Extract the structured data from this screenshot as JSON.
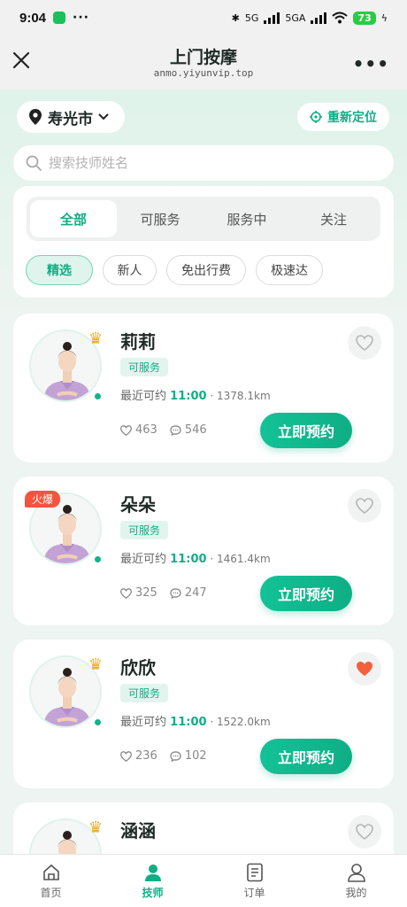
{
  "status_bar": {
    "time": "9:04",
    "network_1": "5G",
    "network_2": "5GA",
    "battery": "73"
  },
  "nav": {
    "title": "上门按摩",
    "subtitle": "anmo.yiyunvip.top"
  },
  "location": {
    "city": "寿光市",
    "relocate_label": "重新定位"
  },
  "search": {
    "placeholder": "搜索技师姓名"
  },
  "tabs": [
    "全部",
    "可服务",
    "服务中",
    "关注"
  ],
  "active_tab": "全部",
  "chips": [
    "精选",
    "新人",
    "免出行费",
    "极速达"
  ],
  "active_chip": "精选",
  "therapists": [
    {
      "name": "莉莉",
      "status": "可服务",
      "avail_label": "最近可约",
      "time": "11:00",
      "distance": "1378.1km",
      "likes": "463",
      "comments": "546",
      "badge": "crown",
      "favorited": false,
      "book_label": "立即预约"
    },
    {
      "name": "朵朵",
      "status": "可服务",
      "avail_label": "最近可约",
      "time": "11:00",
      "distance": "1461.4km",
      "likes": "325",
      "comments": "247",
      "badge": "hot",
      "hot_label": "火爆",
      "favorited": false,
      "book_label": "立即预约"
    },
    {
      "name": "欣欣",
      "status": "可服务",
      "avail_label": "最近可约",
      "time": "11:00",
      "distance": "1522.0km",
      "likes": "236",
      "comments": "102",
      "badge": "crown",
      "favorited": true,
      "book_label": "立即预约"
    },
    {
      "name": "涵涵",
      "badge": "crown",
      "favorited": false
    }
  ],
  "bottom_nav": [
    {
      "label": "首页",
      "icon": "home-icon"
    },
    {
      "label": "技师",
      "icon": "therapist-icon"
    },
    {
      "label": "订单",
      "icon": "order-icon"
    },
    {
      "label": "我的",
      "icon": "profile-icon"
    }
  ],
  "active_bottom_tab": "技师",
  "colors": {
    "accent": "#0fae85",
    "hot": "#f5533d",
    "favorite": "#f2613d"
  }
}
